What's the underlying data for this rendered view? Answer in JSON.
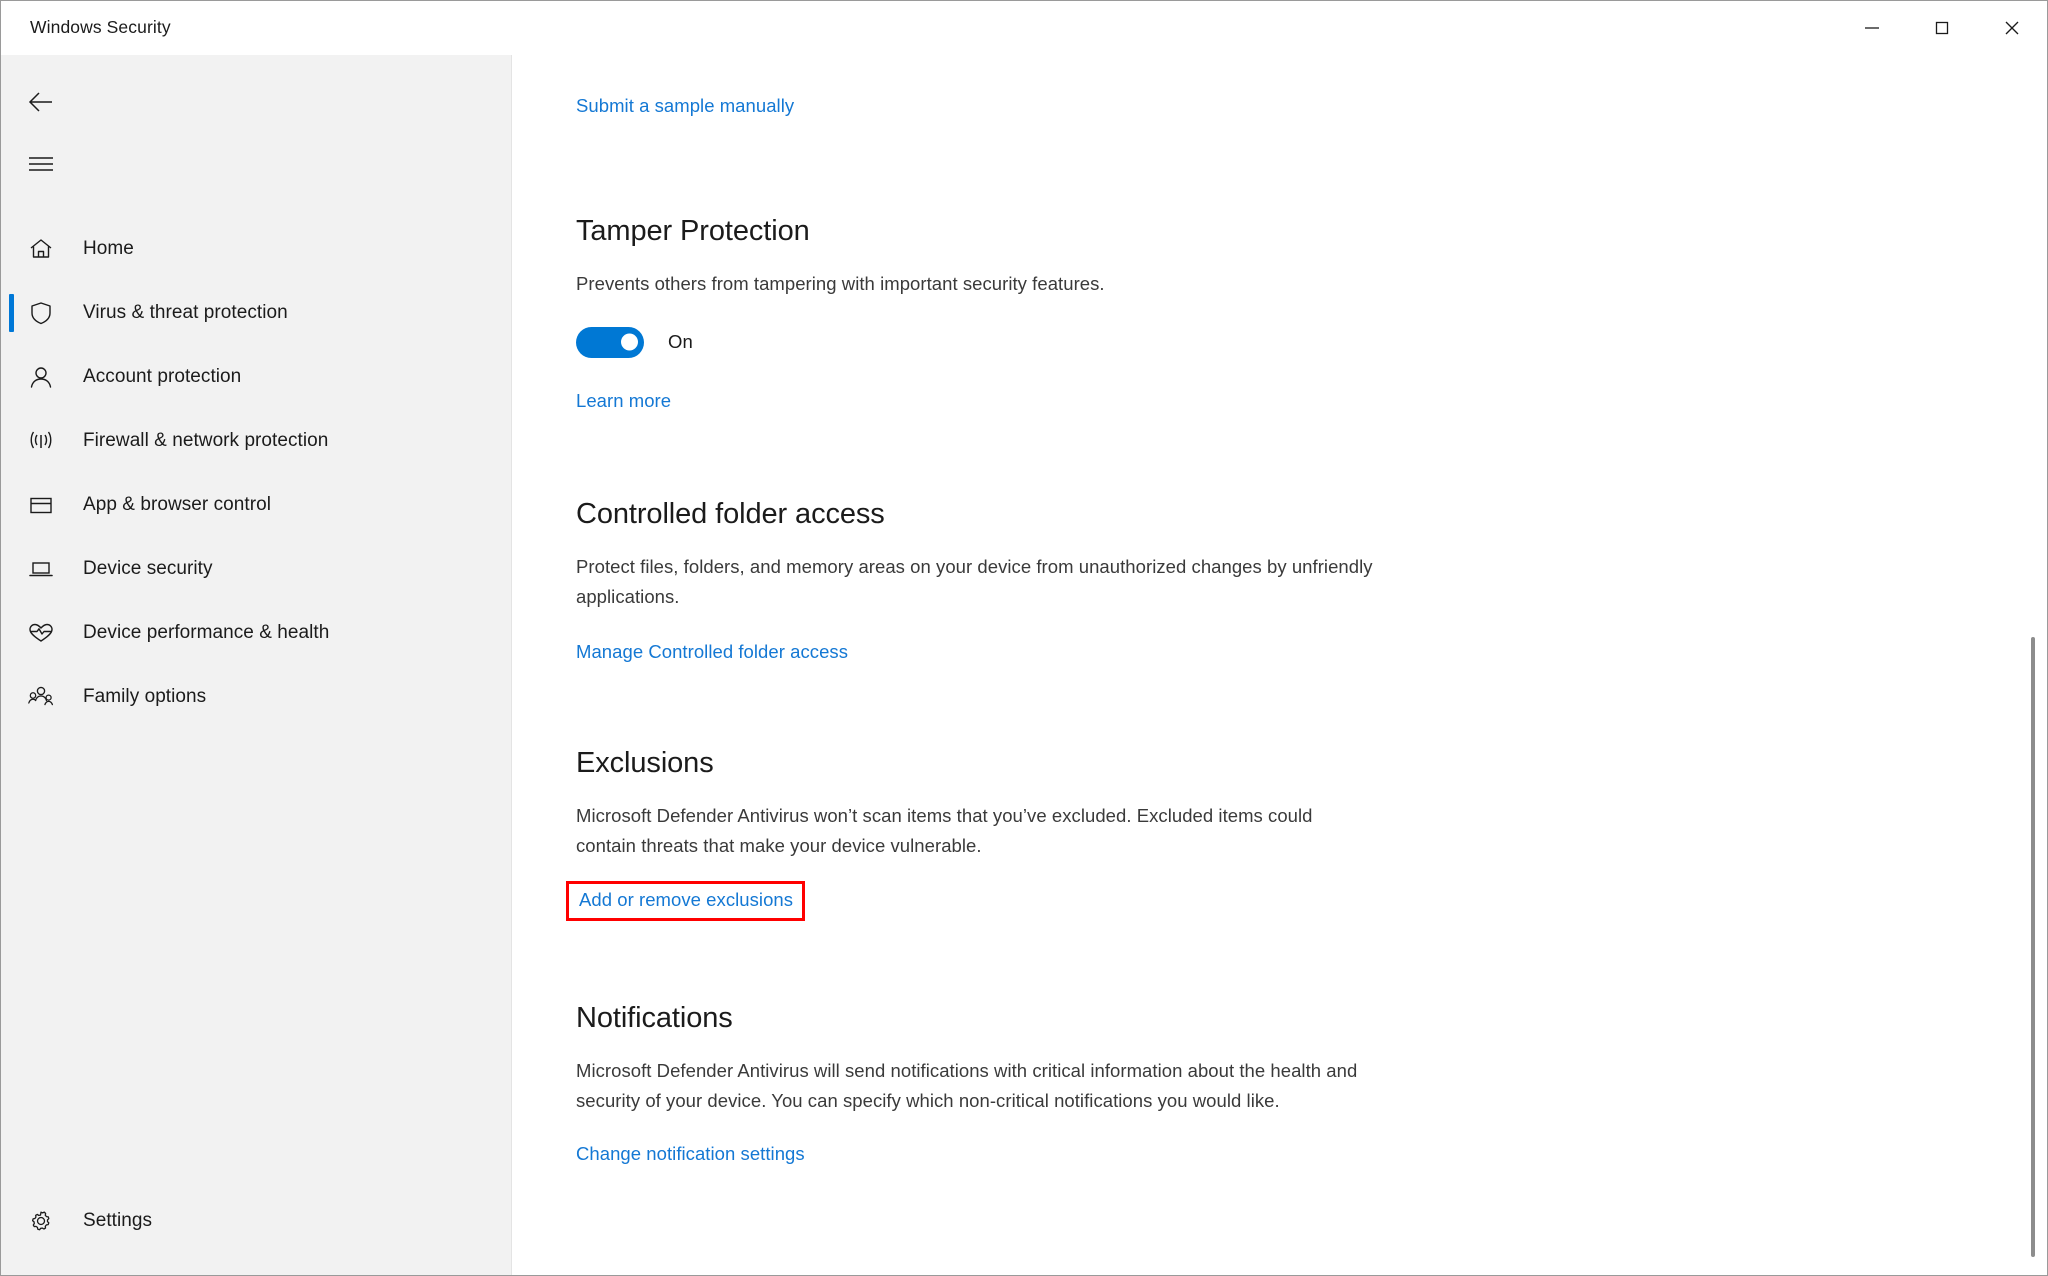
{
  "window": {
    "title": "Windows Security",
    "controls": {
      "minimize": "Minimize",
      "maximize": "Maximize",
      "close": "Close"
    }
  },
  "sidebar": {
    "back_label": "Back",
    "menu_label": "Open navigation menu",
    "items": [
      {
        "label": "Home",
        "icon": "home-icon",
        "selected": false
      },
      {
        "label": "Virus & threat protection",
        "icon": "shield-icon",
        "selected": true
      },
      {
        "label": "Account protection",
        "icon": "person-icon",
        "selected": false
      },
      {
        "label": "Firewall & network protection",
        "icon": "wireless-icon",
        "selected": false
      },
      {
        "label": "App & browser control",
        "icon": "window-icon",
        "selected": false
      },
      {
        "label": "Device security",
        "icon": "laptop-icon",
        "selected": false
      },
      {
        "label": "Device performance & health",
        "icon": "heart-pulse-icon",
        "selected": false
      },
      {
        "label": "Family options",
        "icon": "people-icon",
        "selected": false
      }
    ],
    "settings": {
      "label": "Settings",
      "icon": "gear-icon"
    }
  },
  "main": {
    "submit_sample_link": "Submit a sample manually",
    "sections": [
      {
        "title": "Tamper Protection",
        "description": "Prevents others from tampering with important security features.",
        "toggle": {
          "state_label": "On",
          "on": true,
          "color": "#0078d4"
        },
        "link": "Learn more"
      },
      {
        "title": "Controlled folder access",
        "description": "Protect files, folders, and memory areas on your device from unauthorized changes by unfriendly applications.",
        "link": "Manage Controlled folder access"
      },
      {
        "title": "Exclusions",
        "description": "Microsoft Defender Antivirus won’t scan items that you’ve excluded. Excluded items could contain threats that make your device vulnerable.",
        "link": "Add or remove exclusions",
        "highlighted": true,
        "highlight_color": "#ff0000"
      },
      {
        "title": "Notifications",
        "description": "Microsoft Defender Antivirus will send notifications with critical information about the health and security of your device. You can specify which non-critical notifications you would like.",
        "link": "Change notification settings"
      }
    ]
  },
  "colors": {
    "link": "#1478d4",
    "accent": "#0078d7",
    "sidebar_bg": "#f2f2f2",
    "highlight": "#ff0000"
  }
}
